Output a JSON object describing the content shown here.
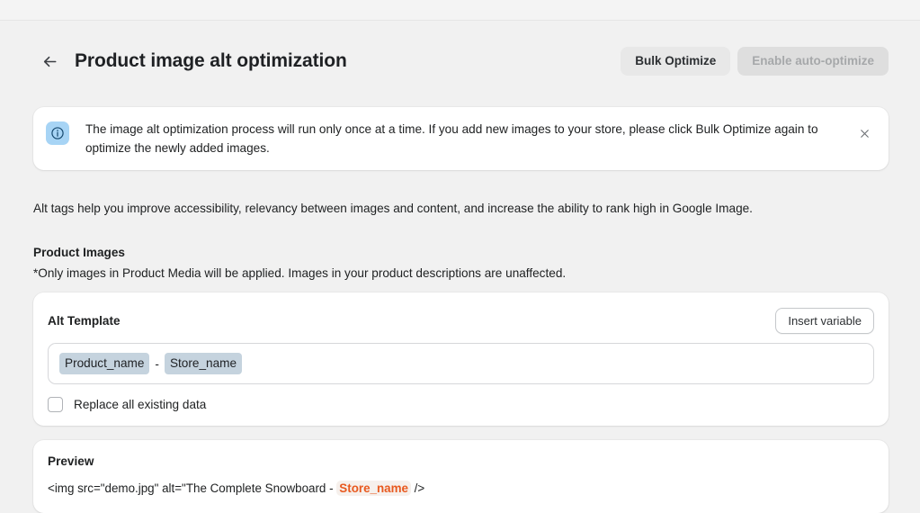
{
  "header": {
    "back_icon": "arrow-left-icon",
    "title": "Product image alt optimization",
    "bulk_optimize_label": "Bulk Optimize",
    "enable_auto_optimize_label": "Enable auto-optimize"
  },
  "banner": {
    "icon": "info-circle-icon",
    "message": "The image alt optimization process will run only once at a time. If you add new images to your store, please click Bulk Optimize again to optimize the newly added images.",
    "close_icon": "close-icon"
  },
  "intro": {
    "description": "Alt tags help you improve accessibility, relevancy between images and content, and increase the ability to rank high in Google Image."
  },
  "product_images": {
    "heading": "Product Images",
    "note": "*Only images in Product Media will be applied. Images in your product descriptions are unaffected."
  },
  "alt_template_card": {
    "title": "Alt Template",
    "insert_variable_label": "Insert variable",
    "input": {
      "chip_1": "Product_name",
      "separator": "-",
      "chip_2": "Store_name"
    },
    "checkbox": {
      "label": "Replace all existing data",
      "checked": false
    }
  },
  "preview_card": {
    "title": "Preview",
    "code_prefix": "<img src=\"demo.jpg\" alt=\"The Complete Snowboard - ",
    "code_variable": "Store_name",
    "code_suffix": " />"
  },
  "colors": {
    "page_background": "#f1f1f1",
    "card_background": "#ffffff",
    "banner_icon_background": "#a7d4f5",
    "chip_background": "#c5d3de",
    "variable_accent": "#e8591f",
    "disabled_button_background": "#dedede",
    "secondary_button_background": "#e8e8e8"
  }
}
